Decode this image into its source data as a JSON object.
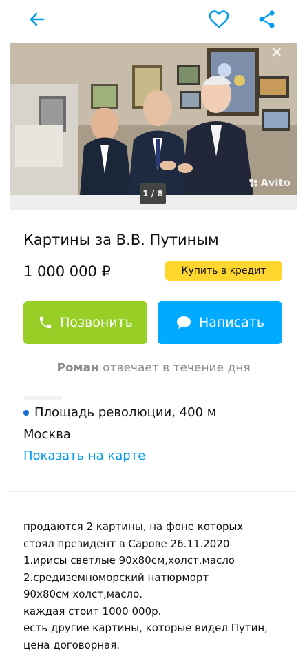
{
  "header": {
    "back_icon": "arrow-left-icon",
    "favorite_icon": "heart-icon",
    "share_icon": "share-icon",
    "accent_color": "#009cf0"
  },
  "gallery": {
    "counter": "1 / 8",
    "watermark": "Avito",
    "close_icon": "close-icon"
  },
  "listing": {
    "title": "Картины за В.В. Путиным",
    "price": "1 000 000 ₽",
    "credit_label": "Купить в кредит"
  },
  "actions": {
    "call_label": "Позвонить",
    "write_label": "Написать",
    "call_color": "#97cf26",
    "write_color": "#00aaff"
  },
  "seller": {
    "name": "Роман",
    "response": "отвечает в течение дня"
  },
  "location": {
    "address": "Площадь революции, 400 м",
    "city": "Москва",
    "map_link": "Показать на карте"
  },
  "description": {
    "lines": [
      "продаются 2 картины, на фоне которых",
      "стоял президент в Сарове 26.11.2020",
      "1.ирисы светлые 90х80см,холст,масло",
      "2.средиземноморский натюрморт",
      "90х80см холст,масло.",
      "каждая стоит 1000 000р.",
      "есть другие картины, которые видел Путин,",
      "цена договорная."
    ]
  }
}
